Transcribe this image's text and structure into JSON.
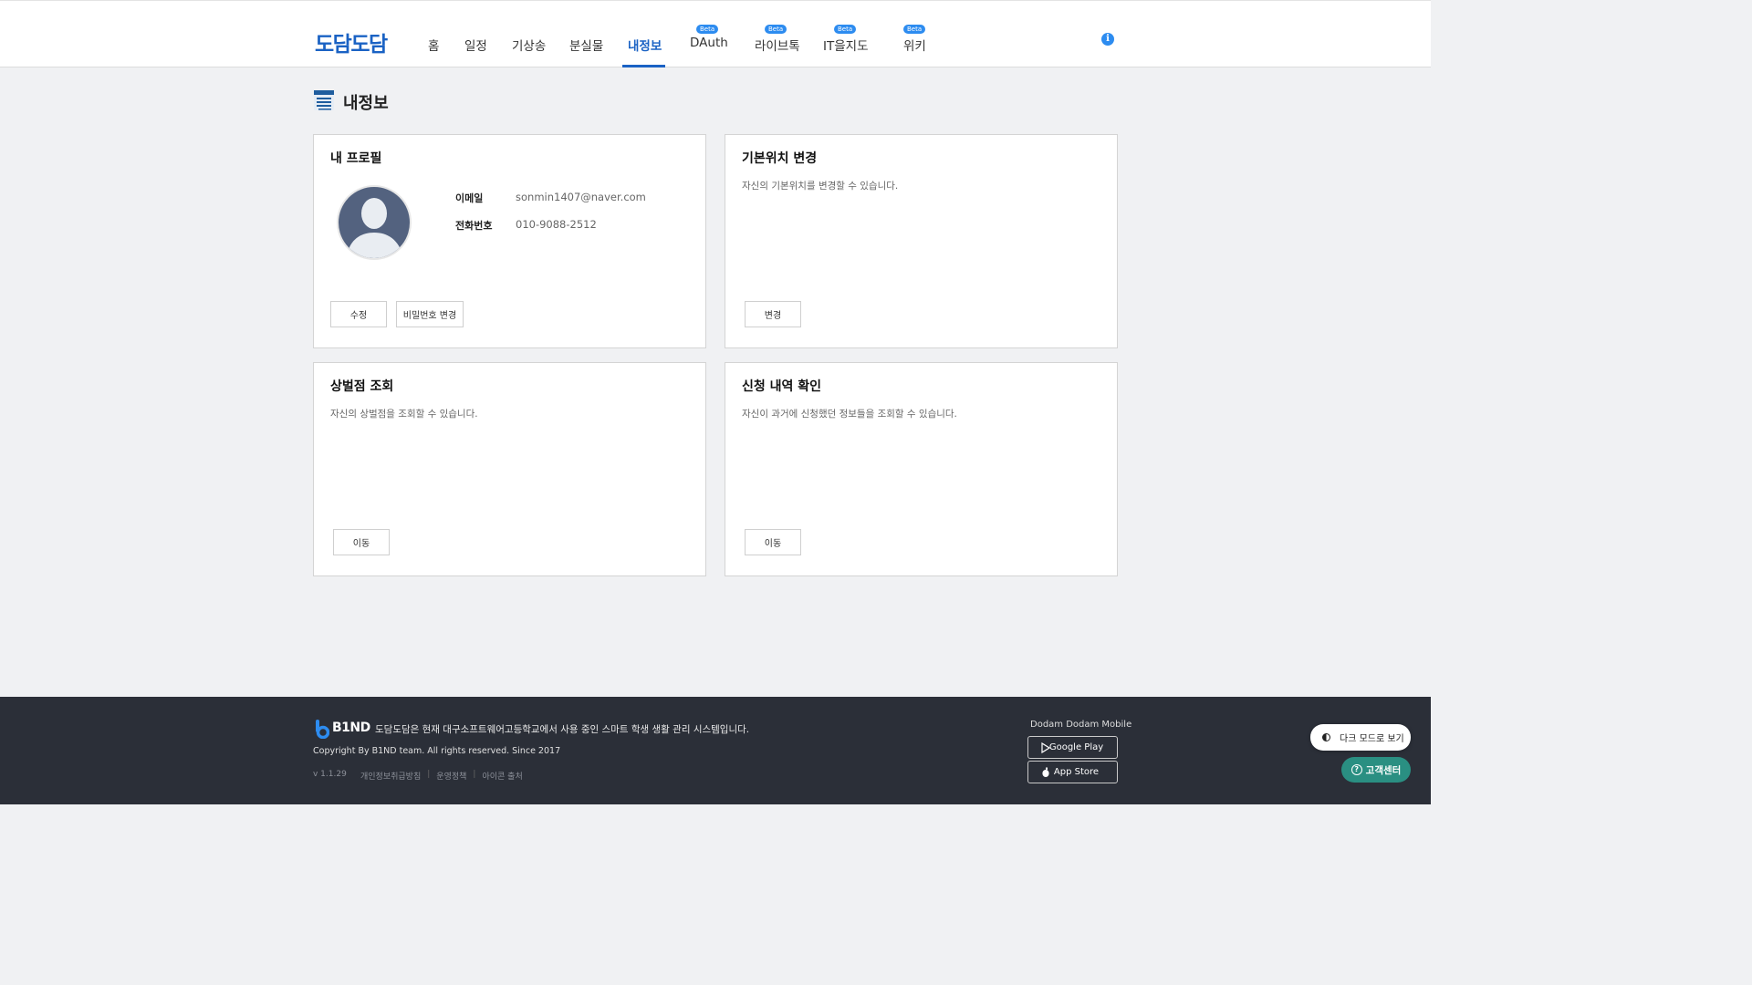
{
  "header": {
    "logo": "도담도담",
    "nav": [
      {
        "label": "홈",
        "beta": ""
      },
      {
        "label": "일정",
        "beta": ""
      },
      {
        "label": "기상송",
        "beta": ""
      },
      {
        "label": "분실물",
        "beta": ""
      },
      {
        "label": "내정보",
        "beta": "",
        "active": true
      },
      {
        "label": "DAuth",
        "beta": "Beta"
      },
      {
        "label": "라이브톡",
        "beta": "Beta"
      },
      {
        "label": "IT을지도",
        "beta": "Beta"
      },
      {
        "label": "위키",
        "beta": "Beta"
      }
    ],
    "info_icon": "i"
  },
  "page": {
    "title": "내정보",
    "icon": "list-document-icon"
  },
  "profile_card": {
    "title": "내 프로필",
    "email_label": "이메일",
    "email": "sonmin1407@naver.com",
    "phone_label": "전화번호",
    "phone": "010-9088-2512",
    "edit_button": "수정",
    "password_button": "비밀번호 변경"
  },
  "location_card": {
    "title": "기본위치 변경",
    "desc": "자신의 기본위치를 변경할 수 있습니다.",
    "button": "변경"
  },
  "points_card": {
    "title": "상벌점 조회",
    "desc": "자신의 상벌점을 조회할 수 있습니다.",
    "button": "이동"
  },
  "history_card": {
    "title": "신청 내역 확인",
    "desc": "자신이 과거에 신청했던 정보들을 조회할 수 있습니다.",
    "button": "이동"
  },
  "footer": {
    "brand": "B1ND",
    "desc": "도담도담은 현재 대구소프트웨어고등학교에서 사용 중인 스마트 학생 생활 관리 시스템입니다.",
    "copyright": "Copyright By B1ND team. All rights reserved. Since 2017",
    "version": "v 1.1.29",
    "links": [
      "개인정보취급방침",
      "운영정책",
      "아이콘 출처"
    ],
    "mobile_title": "Dodam Dodam Mobile",
    "google_play": "Google Play",
    "app_store": "App Store"
  },
  "floating": {
    "dark_mode": "다크 모드로 보기",
    "help": "고객센터"
  },
  "colors": {
    "brand": "#1a62c4",
    "beta": "#2d8cf0",
    "footer_bg": "#2b2f38",
    "help": "#2a8f82"
  }
}
